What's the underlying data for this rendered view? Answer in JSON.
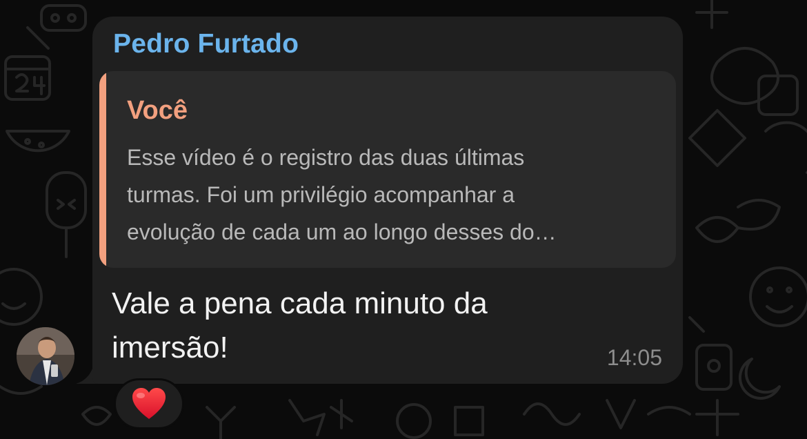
{
  "message": {
    "sender": "Pedro Furtado",
    "quoted": {
      "author": "Você",
      "lines": [
        "Esse vídeo é o registro das duas últimas",
        "turmas. Foi um privilégio acompanhar a",
        "evolução de cada um ao longo desses do…"
      ]
    },
    "text_lines": [
      "Vale a pena cada minuto da",
      "imersão!"
    ],
    "time": "14:05",
    "reaction": "heart",
    "reaction_emoji": "❤️"
  },
  "colors": {
    "background": "#0b0b0b",
    "bubble": "#1f1f1f",
    "quote_background": "#2a2a2a",
    "sender_name": "#6bb4ec",
    "quote_accent": "#f2a07f"
  }
}
